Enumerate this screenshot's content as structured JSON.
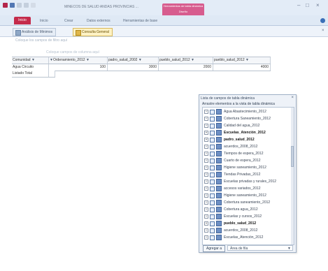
{
  "window": {
    "title": "MINECOS DE SALUD ANDAS PROVINCIAS ...",
    "context_tab": "Herramientas de tabla dinámica",
    "context_sub": "Diseño",
    "controls": [
      "–",
      "□",
      "×"
    ]
  },
  "ribbon": {
    "file_tab": "Inicio",
    "tabs": [
      "Inicio",
      "Crear",
      "Datos externos",
      "Herramientas de base"
    ]
  },
  "doc_tabs": [
    {
      "label": "Análisis de Minimos",
      "active": false
    },
    {
      "label": "Consulta General",
      "active": true
    }
  ],
  "pivot": {
    "filter_hint": "Coloque los campos de filtro aquí",
    "drop_hint": "Coloque campos de columna aquí",
    "header": [
      "Comunidad",
      "Ordenamiento_2012",
      "padro_salud_2002",
      "pueblo_salud_2012",
      "pueblo_salud_2012"
    ],
    "rows": [
      {
        "label": "Agua Circuito",
        "values": [
          "100",
          "3000",
          "2000",
          "4000"
        ]
      },
      {
        "label": "Listado Total",
        "values": [
          "",
          "",
          "",
          ""
        ]
      }
    ]
  },
  "field_list": {
    "title": "Lista de campos de tabla dinámica",
    "subtitle": "Arrastre elementos a la vista de tabla dinámica",
    "items": [
      {
        "label": "Agua Abastecimiento_2012",
        "bold": false
      },
      {
        "label": "Cobertura Saneamiento_2012",
        "bold": false
      },
      {
        "label": "Calidad del agua_2012",
        "bold": false
      },
      {
        "label": "Escuelas_Atención_2012",
        "bold": true
      },
      {
        "label": "padro_salud_2012",
        "bold": true
      },
      {
        "label": "acuerdos_2008_2012",
        "bold": false
      },
      {
        "label": "Tiempos de espera_2012",
        "bold": false
      },
      {
        "label": "Cuarto de espera_2012",
        "bold": false
      },
      {
        "label": "Higiene saneamiento_2012",
        "bold": false
      },
      {
        "label": "Tiendas Privadas_2012",
        "bold": false
      },
      {
        "label": "Escuelas privadas y rurales_2012",
        "bold": false
      },
      {
        "label": "accesos variados_2012",
        "bold": false
      },
      {
        "label": "Higiene saneamiento_2012",
        "bold": false
      },
      {
        "label": "Cobertura saneamiento_2012",
        "bold": false
      },
      {
        "label": "Cobertura agua_2012",
        "bold": false
      },
      {
        "label": "Escuelas y cursos_2012",
        "bold": false
      },
      {
        "label": "pueblo_salud_2012",
        "bold": true
      },
      {
        "label": "acuerdos_2008_2012",
        "bold": false
      },
      {
        "label": "Escuelas_Atención_2012",
        "bold": false
      }
    ],
    "add_button": "Agregar a",
    "add_target": "Área de fila"
  }
}
